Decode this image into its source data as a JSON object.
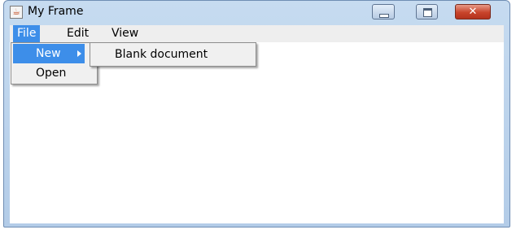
{
  "window": {
    "title": "My Frame",
    "app_icon": "java-icon",
    "controls": {
      "minimize": "minimize-icon",
      "maximize": "maximize-icon",
      "close": "close-icon",
      "close_glyph": "✕"
    }
  },
  "menubar": {
    "items": [
      {
        "label": "File",
        "active": true
      },
      {
        "label": "Edit"
      },
      {
        "label": "View"
      }
    ]
  },
  "file_menu": {
    "items": [
      {
        "label": "New",
        "has_submenu": true,
        "highlighted": true
      },
      {
        "label": "Open"
      }
    ]
  },
  "new_submenu": {
    "items": [
      {
        "label": "Blank document"
      }
    ]
  },
  "colors": {
    "selection": "#3d8ee9",
    "menubar_bg": "#eeeeee",
    "close_button": "#c8442b"
  }
}
